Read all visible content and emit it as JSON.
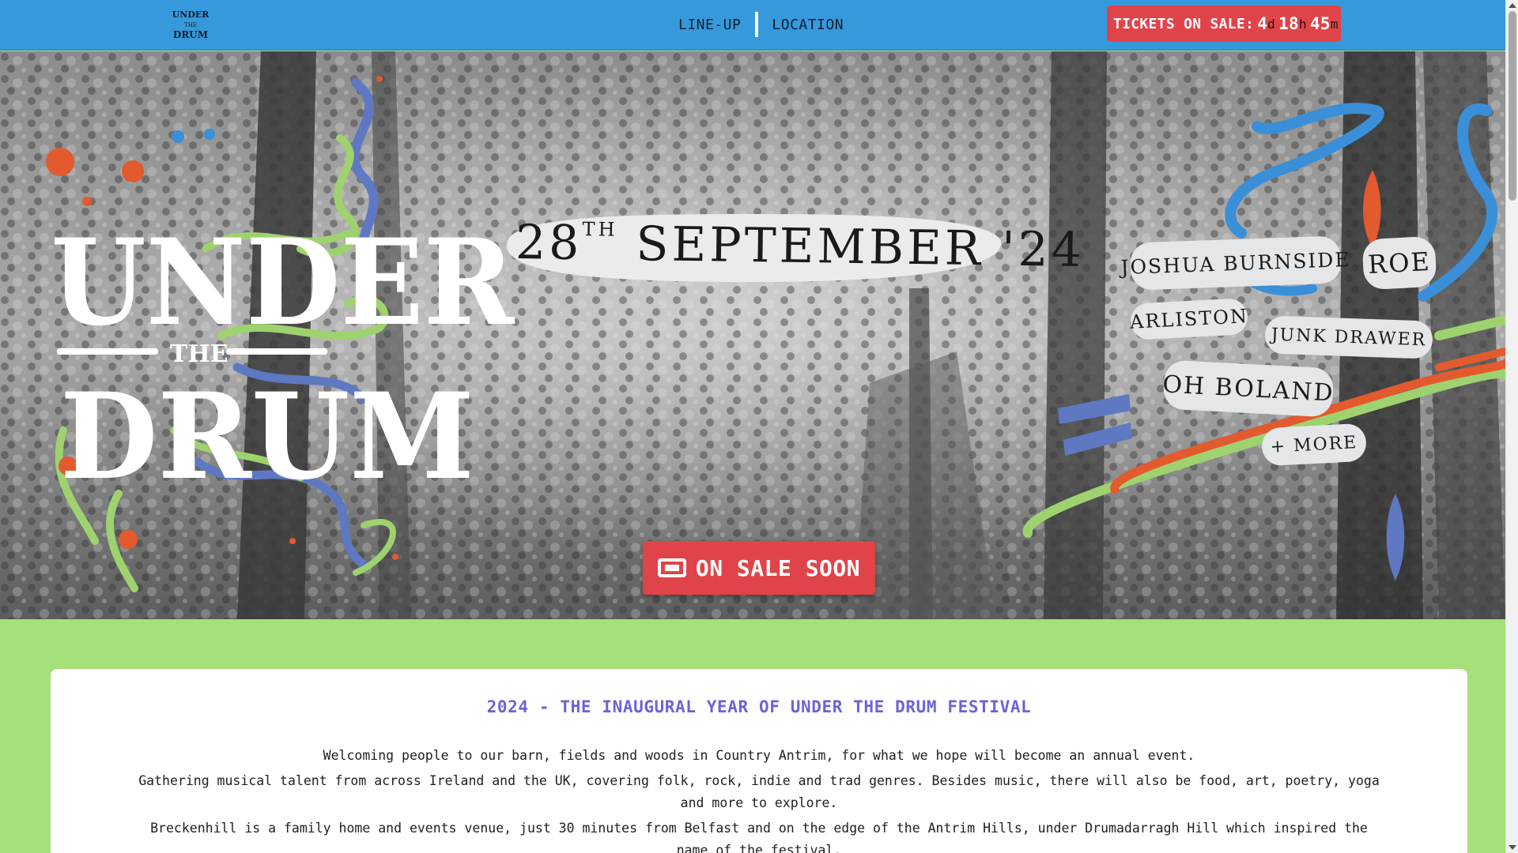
{
  "header": {
    "logo_text": "UNDER THE DRUM",
    "nav": [
      {
        "label": "LINE-UP"
      },
      {
        "label": "LOCATION"
      }
    ],
    "tickets": {
      "label": "TICKETS ON SALE:",
      "days": "4",
      "days_unit": "d",
      "hours": "18",
      "hours_unit": "h",
      "minutes": "45",
      "minutes_unit": "m"
    }
  },
  "hero": {
    "wordmark": {
      "line1": "UNDER",
      "line2": "THE",
      "line3": "DRUM"
    },
    "date": {
      "day": "28",
      "suffix": "TH",
      "rest": "SEPTEMBER '24"
    },
    "cta_label": "ON SALE SOON",
    "acts": [
      "JOSHUA BURNSIDE",
      "ROE",
      "ARLISTON",
      "JUNK DRAWER",
      "OH BOLAND",
      "+ MORE"
    ]
  },
  "about": {
    "title": "2024 - THE INAUGURAL YEAR OF UNDER THE DRUM FESTIVAL",
    "paragraphs": [
      "Welcoming people to our barn, fields and woods in Country Antrim, for what we hope will become an annual event.",
      "Gathering musical talent from across Ireland and the UK, covering folk, rock, indie and trad genres. Besides music, there will also be food, art, poetry, yoga and more to explore.",
      "Breckenhill is a family home and events venue, just 30 minutes from Belfast and on the edge of the Antrim Hills, under Drumadarragh Hill which inspired the name of the festival."
    ]
  },
  "colors": {
    "header_bg": "#3699dc",
    "accent_red": "#e0444a",
    "page_green": "#a6e07a",
    "title_purple": "#6b63d6",
    "swirl_blue": "#3a8fd8",
    "swirl_green": "#9ed26e",
    "swirl_orange": "#e25a2e",
    "swirl_purple": "#5e78c2"
  }
}
